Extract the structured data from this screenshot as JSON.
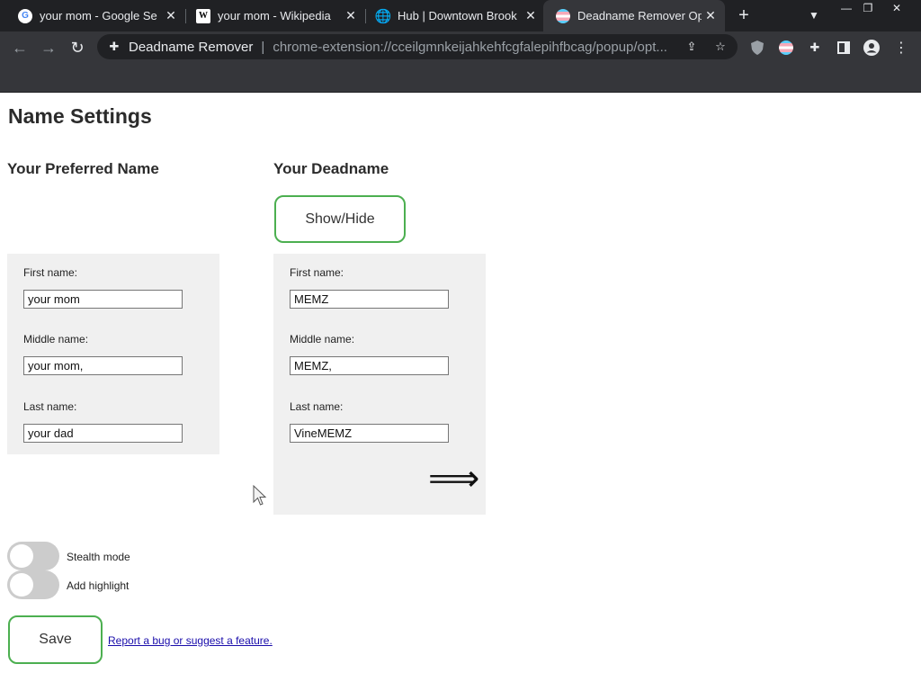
{
  "browser": {
    "tabs": [
      {
        "title": "your mom - Google Se",
        "favicon": "google-icon"
      },
      {
        "title": "your mom - Wikipedia",
        "favicon": "wikipedia-icon"
      },
      {
        "title": "Hub | Downtown Brook",
        "favicon": "globe-icon"
      },
      {
        "title": "Deadname Remover Op",
        "favicon": "trans-flag-icon",
        "active": true
      }
    ],
    "site_name": "Deadname Remover",
    "url": "chrome-extension://cceilgmnkeijahkehfcgfalepihfbcag/popup/opt..."
  },
  "page": {
    "title": "Name Settings",
    "preferred": {
      "heading": "Your Preferred Name",
      "first_label": "First name:",
      "first_value": "your mom",
      "middle_label": "Middle name:",
      "middle_value": "your mom,",
      "last_label": "Last name:",
      "last_value": "your dad"
    },
    "deadname": {
      "heading": "Your Deadname",
      "show_hide_label": "Show/Hide",
      "first_label": "First name:",
      "first_value": "MEMZ",
      "middle_label": "Middle name:",
      "middle_value": "MEMZ,",
      "last_label": "Last name:",
      "last_value": "VineMEMZ",
      "arrow": "⟹"
    },
    "toggles": [
      {
        "label": "Stealth mode",
        "on": false
      },
      {
        "label": "Add highlight",
        "on": false
      }
    ],
    "save_label": "Save",
    "report_link": "Report a bug or suggest a feature."
  },
  "colors": {
    "accent_border": "#4caf50",
    "panel_bg": "#f0f0f0",
    "chrome_dark": "#202124",
    "chrome_toolbar": "#35363a",
    "link": "#1a0dab"
  }
}
